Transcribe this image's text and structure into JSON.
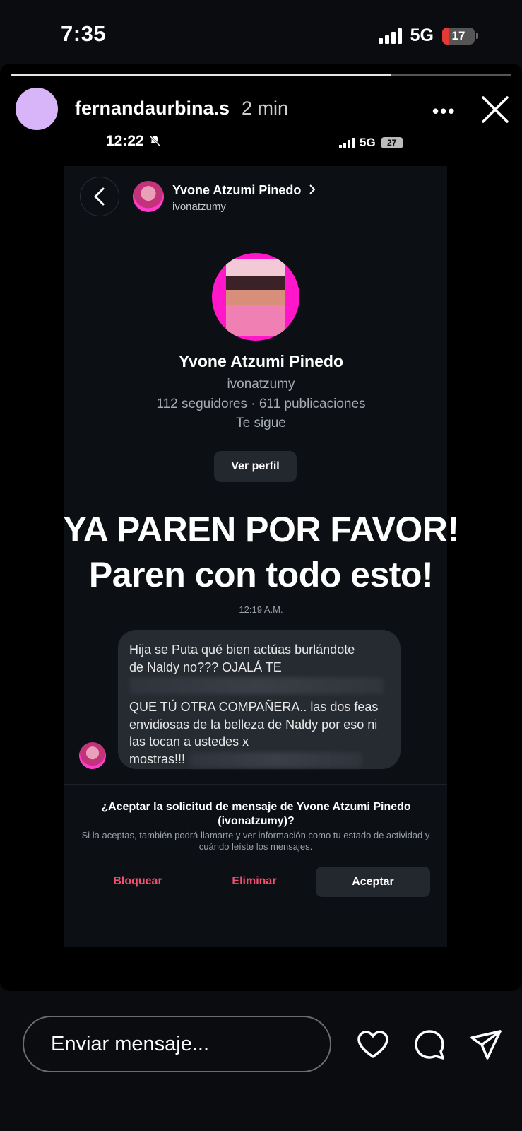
{
  "status_bar": {
    "time": "7:35",
    "network": "5G",
    "battery": "17"
  },
  "story": {
    "progress": 0.76,
    "username": "fernandaurbina.s",
    "time_ago": "2 min",
    "more_icon": "ellipsis-icon",
    "close_icon": "close-icon"
  },
  "inner_status": {
    "time": "12:22",
    "network": "5G",
    "battery": "27"
  },
  "chat_header": {
    "name": "Yvone Atzumi Pinedo",
    "username": "ivonatzumy"
  },
  "profile": {
    "name": "Yvone Atzumi Pinedo",
    "username": "ivonatzumy",
    "stats": "112 seguidores · 611 publicaciones",
    "follows": "Te sigue",
    "view_profile": "Ver perfil"
  },
  "overlay": {
    "line1": "YA PAREN POR FAVOR!",
    "line2": "Paren con todo esto!"
  },
  "message": {
    "time": "12:19 A.M.",
    "line1": "Hija se Puta qué bien actúas burlándote",
    "line2": "de Naldy no??? OJALÁ TE",
    "para2": "QUE TÚ OTRA COMPAÑERA.. las dos feas envidiosas de la belleza de Naldy por eso ni las tocan a ustedes x",
    "last": "mostras!!!"
  },
  "request": {
    "question": "¿Aceptar la solicitud de mensaje de Yvone Atzumi Pinedo (ivonatzumy)?",
    "subtitle": "Si la aceptas, también podrá llamarte y ver información como tu estado de actividad y cuándo leíste los mensajes.",
    "block": "Bloquear",
    "delete": "Eliminar",
    "accept": "Aceptar"
  },
  "bottom": {
    "placeholder": "Enviar mensaje...",
    "icons": [
      "heart-icon",
      "comment-icon",
      "share-icon"
    ]
  }
}
